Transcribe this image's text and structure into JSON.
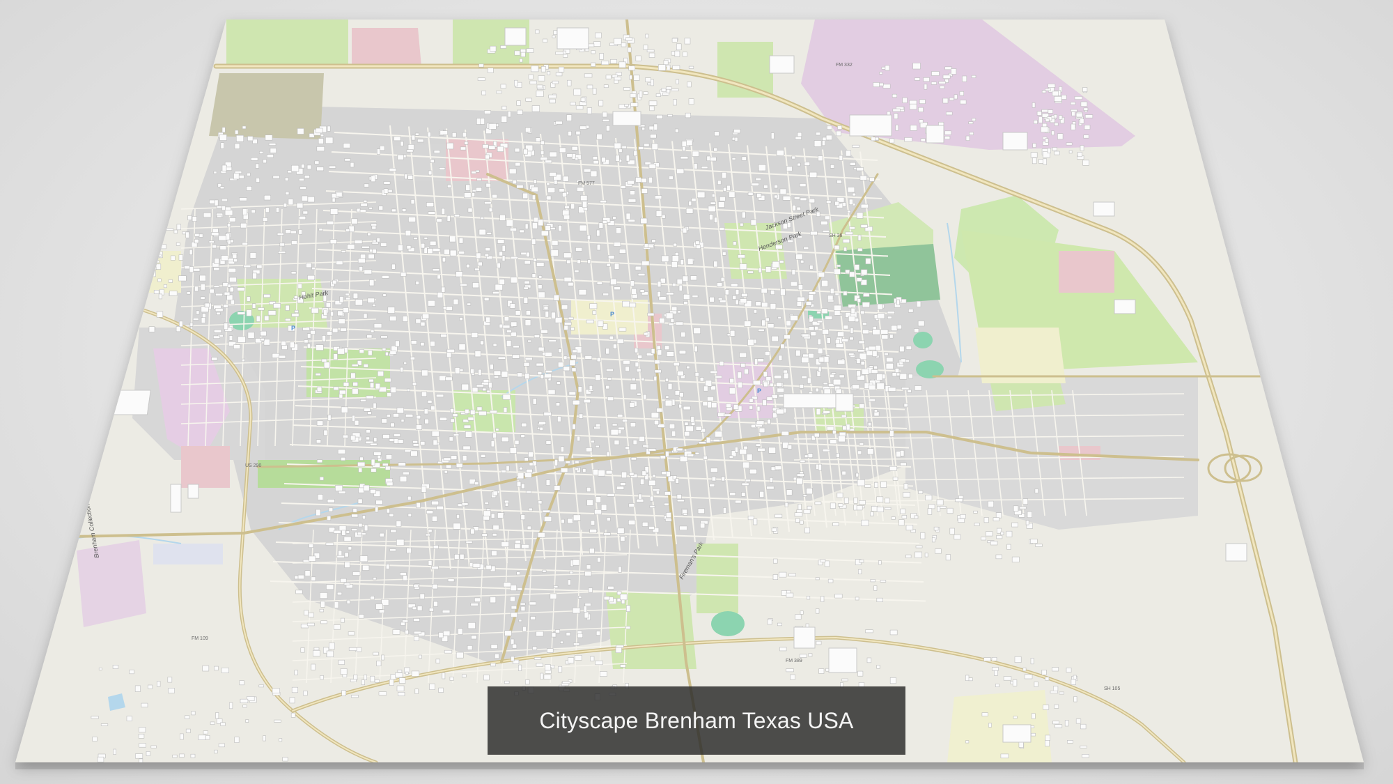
{
  "caption": {
    "title": "Cityscape Brenham Texas USA"
  },
  "map": {
    "labels": [
      "Brenham Collection Transfer Center",
      "Fireman's Park",
      "Henderson Park",
      "Jackson Street Park",
      "Hohlt Park"
    ],
    "road_shields": [
      "US 290",
      "SH 36",
      "FM 577",
      "FM 389",
      "SH 105",
      "FM 332",
      "FM 109"
    ],
    "colors": {
      "land": "#ecebe4",
      "urban_fill": "#d4d4d4",
      "park": "#cfe6b0",
      "sports": "#8cd4b0",
      "commercial": "#e9c7cc",
      "industrial": "#e2cde2",
      "road": "#f7f5ee",
      "highway": "#e6d39a",
      "building": "#fbfbfb",
      "water": "#b4d7ec",
      "caption_bg": "#282828"
    }
  }
}
